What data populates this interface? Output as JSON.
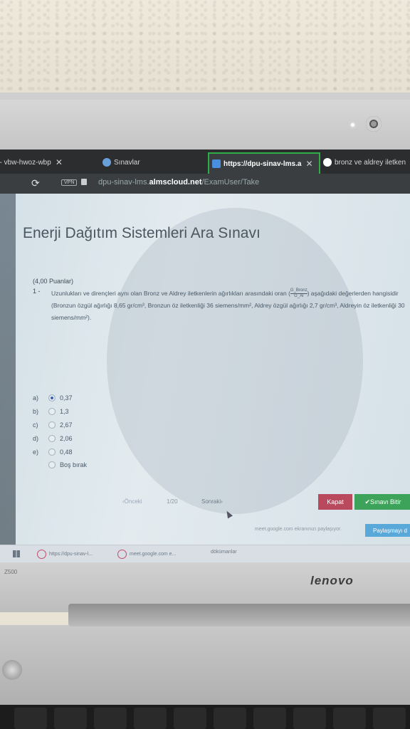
{
  "browser": {
    "tabs": [
      {
        "label": "t - vbw-hwoz-wbp"
      },
      {
        "label": "Sınavlar"
      },
      {
        "label": "https://dpu-sinav-lms.a"
      },
      {
        "label": "bronz ve aldrey iletken"
      }
    ],
    "url_prefix": "dpu-sinav-lms.",
    "url_domain": "almscloud.net",
    "url_path": "/ExamUser/Take",
    "vpn_badge": "VPN"
  },
  "exam": {
    "title": "Enerji Dağıtım Sistemleri Ara Sınavı",
    "points": "(4,00 Puanlar)",
    "question_number": "1 -",
    "question_part1": "Uzunlukları ve dirençleri aynı olan Bronz ve Aldrey iletkenlerin ağırlıkları arasındaki oran (",
    "frac_num": "G_Bronz",
    "frac_den": "G_Al",
    "question_part2": ") aşağıdaki değerlerden hangisidir (Bronzun özgül ağırlığı 8,65 gr/cm³, Bronzun öz iletkenliği 36 siemens/mm², Aldrey özgül ağırlığı 2,7 gr/cm³, Aldreyin öz iletkenliği 30 siemens/mm²).",
    "options": [
      {
        "label": "a)",
        "value": "0,37",
        "selected": true
      },
      {
        "label": "b)",
        "value": "1,3",
        "selected": false
      },
      {
        "label": "c)",
        "value": "2,67",
        "selected": false
      },
      {
        "label": "d)",
        "value": "2,06",
        "selected": false
      },
      {
        "label": "e)",
        "value": "0,48",
        "selected": false
      },
      {
        "label": "",
        "value": "Boş bırak",
        "selected": false
      }
    ],
    "nav_prev": "‹Önceki",
    "nav_page": "1/20",
    "nav_next": "Sonraki›",
    "close_button": "Kapat",
    "finish_button": "✔Sınavı Bitir"
  },
  "share_bar": {
    "text": "meet.google.com ekranınızı paylaşıyor.",
    "button": "Paylaşmayı d"
  },
  "taskbar": {
    "items": [
      {
        "label": "https://dpu-sinav-l..."
      },
      {
        "label": "meet.google.com e..."
      },
      {
        "label": "dökümanlar"
      }
    ]
  },
  "laptop": {
    "model": "Z500",
    "brand": "lenovo"
  }
}
